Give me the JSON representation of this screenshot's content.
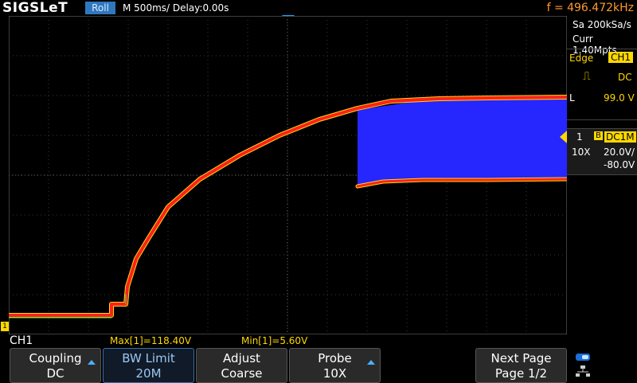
{
  "top": {
    "logo": "SIGSLeT",
    "mode": "Roll",
    "timebase": "M 500ms/  Delay:0.00s",
    "frequency": "f = 496.472kHz"
  },
  "right_panel": {
    "sample_rate": "Sa 200kSa/s",
    "memory": "Curr 1.40Mpts",
    "trigger": {
      "type": "Edge",
      "source": "CH1",
      "coupling": "DC",
      "level_label": "L",
      "level": "99.0 V"
    },
    "channel": {
      "number": "1",
      "bw_flag": "B",
      "coupling": "DC1M",
      "probe": "10X",
      "scale": "20.0V/",
      "offset": "-80.0V"
    }
  },
  "ground_marker": "1",
  "measure": {
    "channel": "CH1",
    "max": "Max[1]=118.40V",
    "min": "Min[1]=5.60V"
  },
  "softkeys": [
    {
      "line1": "Coupling",
      "line2": "DC"
    },
    {
      "line1": "BW Limit",
      "line2": "20M"
    },
    {
      "line1": "Adjust",
      "line2": "Coarse"
    },
    {
      "line1": "Probe",
      "line2": "10X"
    },
    {
      "line1": "Next Page",
      "line2": "Page 1/2"
    }
  ],
  "colors": {
    "trace_core": "#ff1f1f",
    "trace_fill": "#2222ff",
    "channel": "#ffd800",
    "accent": "#2f78bf",
    "frequency": "#ff9a2e"
  }
}
